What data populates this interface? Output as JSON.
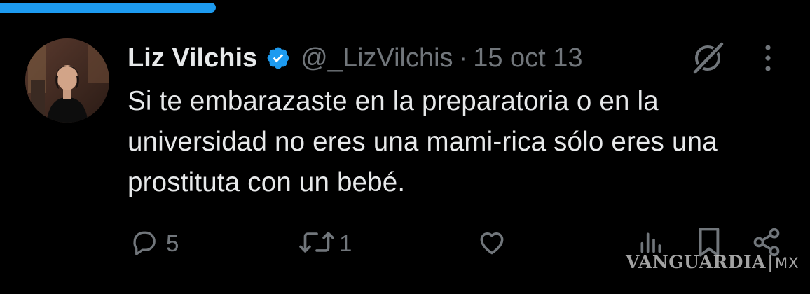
{
  "tweet": {
    "author_name": "Liz Vilchis",
    "handle": "@_LizVilchis",
    "separator": "·",
    "date": "15 oct 13",
    "text": "Si te embarazaste en la preparatoria o en la universidad no eres una mami-rica sólo eres una prostituta con un bebé."
  },
  "actions": {
    "replies": "5",
    "retweets": "1"
  },
  "watermark": {
    "brand": "VANGUARDIA",
    "separator": "|",
    "suffix": "MX"
  },
  "icons": {
    "verified": "verified-badge-icon",
    "grok": "grok-icon",
    "more": "more-options-icon",
    "reply": "reply-icon",
    "retweet": "retweet-icon",
    "like": "like-icon",
    "views": "views-icon",
    "bookmark": "bookmark-icon",
    "share": "share-icon"
  },
  "colors": {
    "background": "#000000",
    "text": "#e7e9ea",
    "secondary": "#71767b",
    "accent": "#1d9bf0"
  }
}
